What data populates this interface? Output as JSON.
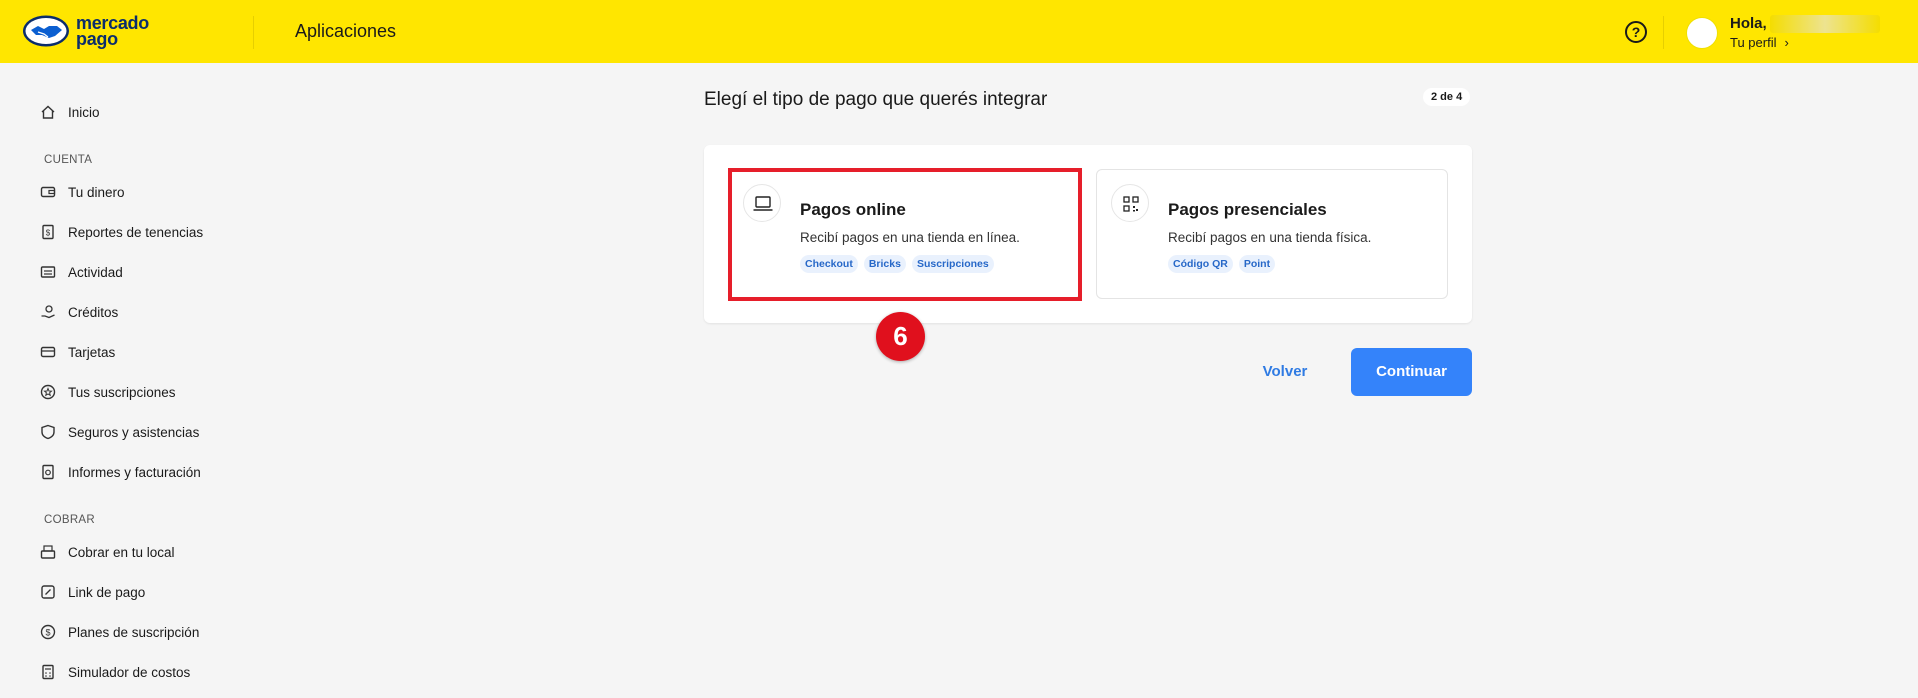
{
  "header": {
    "brand_line1": "mercado",
    "brand_line2": "pago",
    "title": "Aplicaciones",
    "help_icon": "question-circle-icon",
    "greeting": "Hola,",
    "profile_link": "Tu perfil",
    "brand_color": "#ffe600"
  },
  "sidebar": {
    "home": "Inicio",
    "section_cuenta": "CUENTA",
    "cuenta_items": [
      "Tu dinero",
      "Reportes de tenencias",
      "Actividad",
      "Créditos",
      "Tarjetas",
      "Tus suscripciones",
      "Seguros y asistencias",
      "Informes y facturación"
    ],
    "section_cobrar": "COBRAR",
    "cobrar_items": [
      "Cobrar en tu local",
      "Link de pago",
      "Planes de suscripción",
      "Simulador de costos"
    ]
  },
  "main": {
    "title": "Elegí el tipo de pago que querés integrar",
    "step": "2 de 4",
    "options": [
      {
        "title": "Pagos online",
        "description": "Recibí pagos en una tienda en línea.",
        "icon": "laptop-icon",
        "chips": [
          "Checkout",
          "Bricks",
          "Suscripciones"
        ]
      },
      {
        "title": "Pagos presenciales",
        "description": "Recibí pagos en una tienda física.",
        "icon": "qr-code-icon",
        "chips": [
          "Código QR",
          "Point"
        ]
      }
    ],
    "back_label": "Volver",
    "continue_label": "Continuar",
    "accent_color": "#3483fa"
  },
  "annotation": {
    "marker_number": "6",
    "highlight_color": "#e61e2a"
  }
}
